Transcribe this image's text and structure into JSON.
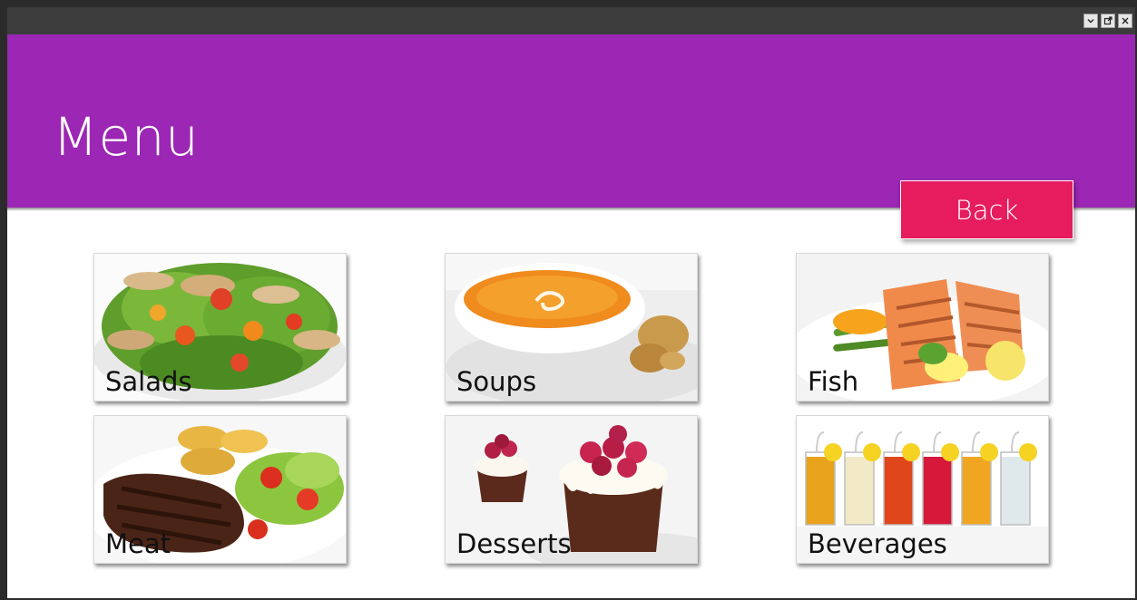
{
  "app": {
    "title": "Menu",
    "window_controls": [
      {
        "name": "minimize",
        "icon": "chevron-down-icon"
      },
      {
        "name": "restore",
        "icon": "popout-icon"
      },
      {
        "name": "close",
        "icon": "close-icon"
      }
    ]
  },
  "header": {
    "color": "#9b27b4",
    "back_label": "Back",
    "back_color": "#e61c5f"
  },
  "tiles": [
    {
      "label": "Salads",
      "image": "salad-photo"
    },
    {
      "label": "Soups",
      "image": "soup-photo"
    },
    {
      "label": "Fish",
      "image": "grilled-salmon-photo"
    },
    {
      "label": "Meat",
      "image": "steak-photo"
    },
    {
      "label": "Desserts",
      "image": "cupcake-photo"
    },
    {
      "label": "Beverages",
      "image": "drinks-photo"
    }
  ]
}
